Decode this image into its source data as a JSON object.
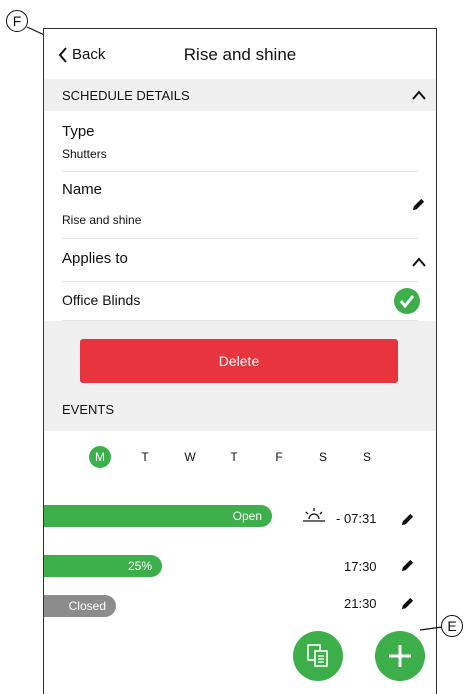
{
  "callouts": {
    "f": "F",
    "e": "E"
  },
  "header": {
    "back_label": "Back",
    "title": "Rise and shine"
  },
  "schedule_details": {
    "heading": "SCHEDULE DETAILS"
  },
  "type_row": {
    "label": "Type",
    "value": "Shutters"
  },
  "name_row": {
    "label": "Name",
    "value": "Rise and shine"
  },
  "applies_to": {
    "label": "Applies to",
    "item": "Office Blinds"
  },
  "delete": {
    "label": "Delete"
  },
  "events": {
    "heading": "EVENTS",
    "days": [
      "M",
      "T",
      "W",
      "T",
      "F",
      "S",
      "S"
    ],
    "selected_day": 0,
    "items": [
      {
        "state": "Open",
        "time": "- 07:31",
        "level": 1.0,
        "sunrise": true
      },
      {
        "state": "25%",
        "time": "17:30",
        "level": 0.25,
        "sunrise": false
      },
      {
        "state": "Closed",
        "time": "21:30",
        "level": 0.0,
        "sunrise": false
      }
    ]
  },
  "colors": {
    "accent_green": "#3daf4a",
    "delete_red": "#e8343d",
    "closed_gray": "#8c8c8c",
    "section_bg": "#f0f0f0"
  },
  "icons": [
    "chevron-left-icon",
    "chevron-up-icon",
    "pencil-icon",
    "check-circle-icon",
    "sunrise-icon",
    "copy-icon",
    "plus-icon"
  ]
}
